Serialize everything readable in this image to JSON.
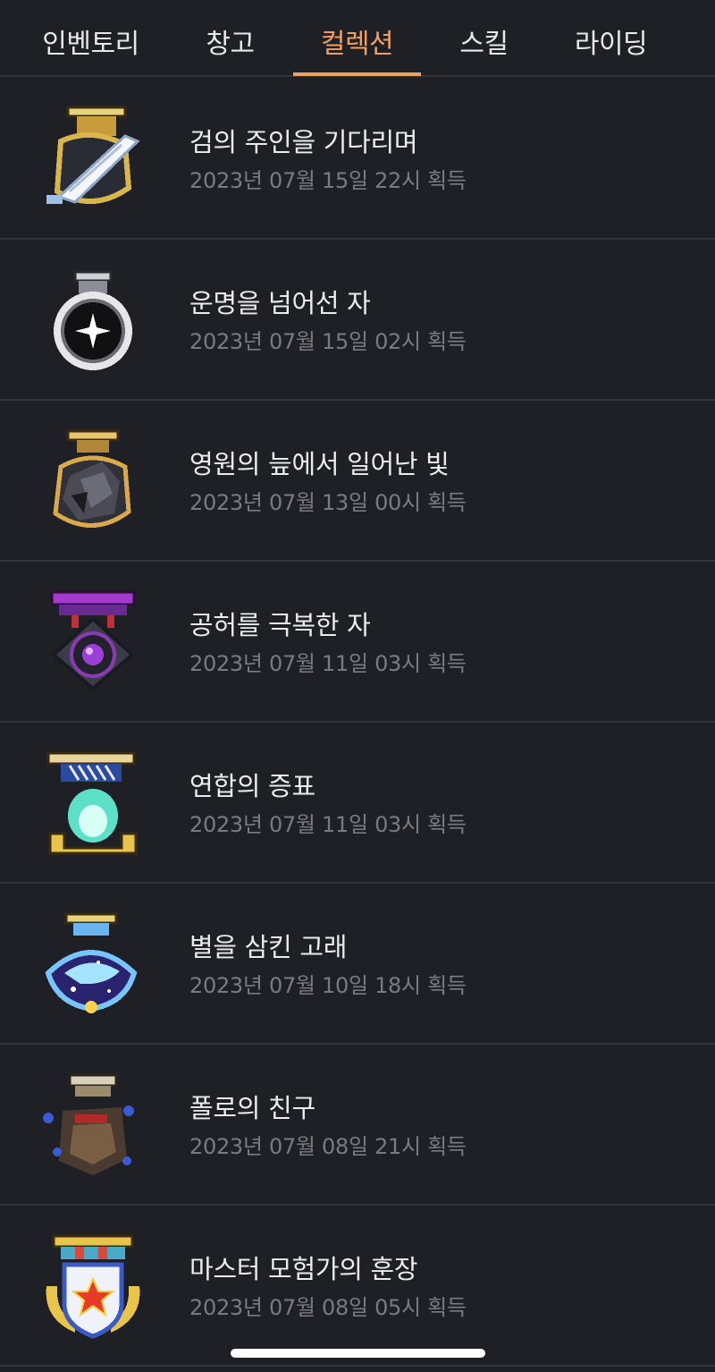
{
  "tabs": [
    {
      "label": "인벤토리",
      "active": false
    },
    {
      "label": "창고",
      "active": false
    },
    {
      "label": "컬렉션",
      "active": true
    },
    {
      "label": "스킬",
      "active": false
    },
    {
      "label": "라이딩",
      "active": false
    }
  ],
  "accent_color": "#f0a063",
  "items": [
    {
      "icon": "white-feather-medal-icon",
      "title": "검의 주인을 기다리며",
      "date": "2023년 07월 15일 22시 획득"
    },
    {
      "icon": "silver-star-orb-medal-icon",
      "title": "운명을 넘어선 자",
      "date": "2023년 07월 15일 02시 획득"
    },
    {
      "icon": "dark-stone-medal-icon",
      "title": "영원의 늪에서 일어난 빛",
      "date": "2023년 07월 13일 00시 획득"
    },
    {
      "icon": "purple-void-orb-medal-icon",
      "title": "공허를 극복한 자",
      "date": "2023년 07월 11일 03시 획득"
    },
    {
      "icon": "cyan-flame-medal-icon",
      "title": "연합의 증표",
      "date": "2023년 07월 11일 03시 획득"
    },
    {
      "icon": "starry-whale-medal-icon",
      "title": "별을 삼킨 고래",
      "date": "2023년 07월 10일 18시 획득"
    },
    {
      "icon": "polo-friend-medal-icon",
      "title": "폴로의 친구",
      "date": "2023년 07월 08일 21시 획득"
    },
    {
      "icon": "master-adventurer-medal-icon",
      "title": "마스터 모험가의 훈장",
      "date": "2023년 07월 08일 05시 획득"
    }
  ]
}
